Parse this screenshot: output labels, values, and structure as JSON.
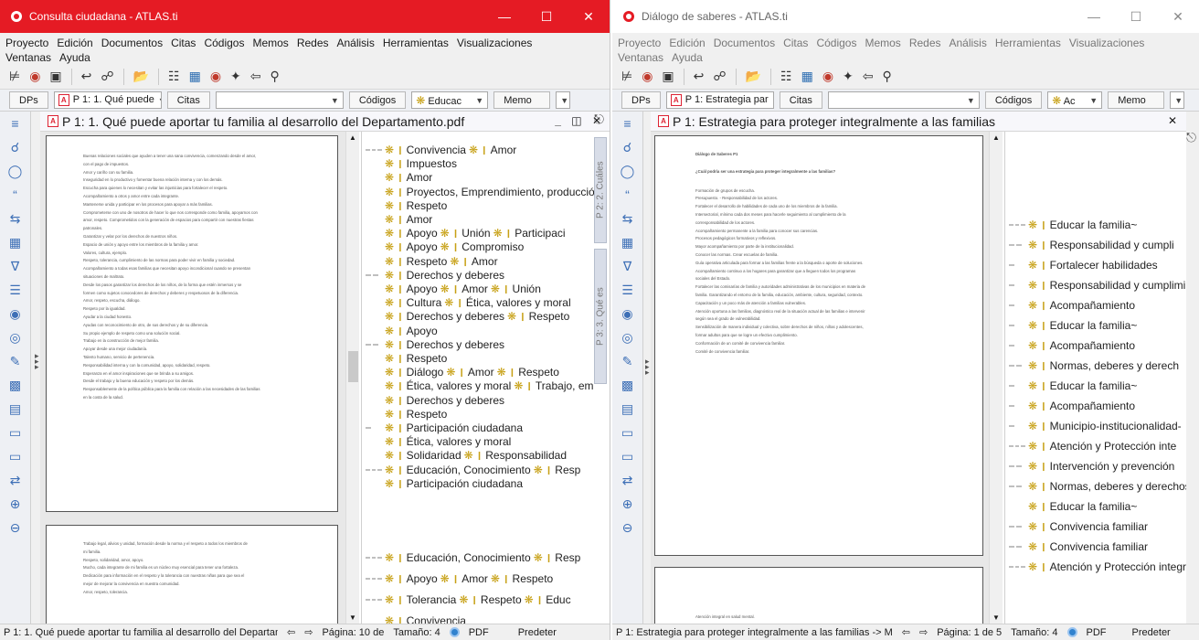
{
  "left": {
    "title": "Consulta ciudadana - ATLAS.ti",
    "menu": [
      "Proyecto",
      "Edición",
      "Documentos",
      "Citas",
      "Códigos",
      "Memos",
      "Redes",
      "Análisis",
      "Herramientas",
      "Visualizaciones",
      "Ventanas",
      "Ayuda"
    ],
    "nav": {
      "dps": "DPs",
      "doc_combo": "P 1: 1. Qué puede",
      "citas": "Citas",
      "citas_combo": "",
      "codigos": "Códigos",
      "codigos_combo": "Educac",
      "memo": "Memo"
    },
    "doc_title": "P 1: 1. Qué puede aportar tu familia al desarrollo del Departamento.pdf",
    "vtabs": [
      "P 2: 2. Cuáles",
      "P 3: 3. Qué es"
    ],
    "page1_lines": [
      "Buenas relaciones sociales que ayuden a tener una sana convivencia, comenzando desde el amor,",
      "con el pago de impuestos.",
      "Amor y cariño con su familia.",
      "Inseguridad en lo productivo y fomentar buena relación interna y con los demás.",
      "Escucha para quienes lo necesitan y evitar las injusticias para fortalecer el respeto.",
      "Acompañamiento a otros y amor entre cada integrante.",
      "Mantenerse unida y participar en los procesos para apoyar a más familias.",
      "Comprometerse con uno de nosotros de hacer lo que nos corresponde como familia, apoyarnos con",
      "amor, respeto. Comprometidos con la generación de espacios para compartir con nuestras fiestas",
      "patronales.",
      "Garantizar y velar por los derechos de nuestros niños.",
      "Espacio de unión y apoyo entre los miembros de la familia y amor.",
      "Valores, cultura, ejemplo.",
      "Respeto, tolerancia, cumplimiento de las normas para poder vivir en familia y sociedad.",
      "Acompañamiento a todas esas familias que necesitan apoyo incondicional cuando se presentan",
      "situaciones de maltrato.",
      "Desde los pasos garantizar los derechos de los niños, de la forma que estén inmersos y se",
      "formen como sujetos conocedores de derechos y deberes y respetuosos de la diferencia.",
      "Amor, respeto, escucha, diálogo.",
      "Respeto por la igualdad.",
      "Ayudar a la ciudad honesto.",
      "Ayudas con reconocimiento de otro, de sus derechos y de su diferencia.",
      "Su propio ejemplo de respeto como una solución social.",
      "Trabajo en la construcción de mejor familia.",
      "Apoyar desde una mejor ciudadanía.",
      "Talento humano, servicio de pertenencia.",
      "Responsabilidad interna y con la comunidad, apoyo, solidaridad, respeto.",
      "Esperanza en el amor inspiraciones que se brinda a su amigos.",
      "Desde el trabajo y la buena educación y respeto por los demás.",
      "Responsablemente de la política pública para la familia con relación a las necesidades de las familias",
      "en la costa de la salud."
    ],
    "page2_lines": [
      "Trabajo legal, alivios y unidad, formación desde la norma y el respeto a todos los miembros de",
      "mi familia.",
      "Respeto, solidaridad, amor, apoyo.",
      "Mucho, cada integrante de mi familia es un núcleo muy esencial para tener una fortaleza.",
      "Dedicación para información en el respeto y la tolerancia con nuestras niñas para que sea el",
      "mejor de mejorar la convivencia en nuestra comunidad.",
      "Amor, respeto, tolerancia."
    ],
    "codes": [
      {
        "bars": 3,
        "items": [
          "Convivencia",
          "Amor"
        ]
      },
      {
        "bars": 0,
        "items": [
          "Impuestos"
        ]
      },
      {
        "bars": 0,
        "items": [
          "Amor"
        ]
      },
      {
        "bars": 0,
        "items": [
          "Proyectos, Emprendimiento, producción"
        ]
      },
      {
        "bars": 0,
        "items": [
          "Respeto"
        ]
      },
      {
        "bars": 0,
        "items": [
          "Amor"
        ]
      },
      {
        "bars": 0,
        "items": [
          "Apoyo",
          "Unión",
          "Participaci"
        ]
      },
      {
        "bars": 0,
        "items": [
          "Apoyo",
          "Compromiso"
        ]
      },
      {
        "bars": 0,
        "items": [
          "Respeto",
          "Amor"
        ]
      },
      {
        "bars": 2,
        "items": [
          "Derechos y deberes"
        ]
      },
      {
        "bars": 0,
        "items": [
          "Apoyo",
          "Amor",
          "Unión"
        ]
      },
      {
        "bars": 0,
        "items": [
          "Cultura",
          "Ética, valores y moral"
        ]
      },
      {
        "bars": 0,
        "items": [
          "Derechos y deberes",
          "Respeto"
        ]
      },
      {
        "bars": 0,
        "items": [
          "Apoyo"
        ]
      },
      {
        "bars": 2,
        "items": [
          "Derechos y deberes"
        ]
      },
      {
        "bars": 0,
        "items": [
          "Respeto"
        ]
      },
      {
        "bars": 0,
        "items": [
          "Diálogo",
          "Amor",
          "Respeto"
        ]
      },
      {
        "bars": 0,
        "items": [
          "Ética, valores y moral",
          "Trabajo, em"
        ]
      },
      {
        "bars": 0,
        "items": [
          "Derechos y deberes"
        ]
      },
      {
        "bars": 0,
        "items": [
          "Respeto"
        ]
      },
      {
        "bars": 1,
        "items": [
          "Participación ciudadana"
        ]
      },
      {
        "bars": 0,
        "items": [
          "Ética, valores y moral"
        ]
      },
      {
        "bars": 0,
        "items": [
          "Solidaridad",
          "Responsabilidad"
        ]
      },
      {
        "bars": 3,
        "items": [
          "Educación, Conocimiento",
          "Resp"
        ]
      },
      {
        "bars": 0,
        "items": [
          "Participación ciudadana"
        ]
      }
    ],
    "codes_lower": [
      {
        "bars": 3,
        "items": [
          "Educación, Conocimiento",
          "Resp"
        ]
      },
      {
        "bars": 3,
        "items": [
          "Apoyo",
          "Amor",
          "Respeto"
        ]
      },
      {
        "bars": 3,
        "items": [
          "Tolerancia",
          "Respeto",
          "Educ"
        ]
      },
      {
        "bars": 0,
        "items": [
          "Convivencia"
        ]
      }
    ],
    "status": {
      "doc": "P 1: 1. Qué puede aportar tu familia al desarrollo del Departamento",
      "page": "Página: 10 de",
      "size": "Tamaño: 4",
      "type": "PDF",
      "mode": "Predeter"
    }
  },
  "right": {
    "title": "Diálogo de saberes - ATLAS.ti",
    "menu": [
      "Proyecto",
      "Edición",
      "Documentos",
      "Citas",
      "Códigos",
      "Memos",
      "Redes",
      "Análisis",
      "Herramientas",
      "Visualizaciones",
      "Ventanas",
      "Ayuda"
    ],
    "nav": {
      "dps": "DPs",
      "doc_combo": "P 1: Estrategia par",
      "citas": "Citas",
      "citas_combo": "",
      "codigos": "Códigos",
      "codigos_combo": "Ac",
      "memo": "Memo"
    },
    "doc_title": "P 1: Estrategia para proteger integralmente a las familias",
    "page_heading": "Diálogo de Saberes P1",
    "page_question": "¿Cuál podría ser una estrategia para proteger integralmente a las familias?",
    "page_lines": [
      "Formación de grupos de escucha.",
      "Presupuesto. - Responsabilidad de los actores.",
      "Fortalecer el desarrollo de habilidades de cada uno de los miembros de la familia.",
      "Intersectorial, mínimo cada dos meses para hacerle seguimiento al cumplimiento de la",
      "corresponsabilidad de los actores.",
      "Acompañamiento permanente a la familia para conocer sus carencias.",
      "Procesos pedagógicos formativos y reflexivos.",
      "Mayor acompañamiento por parte de la institucionalidad.",
      "Conocer las normas. Crear escuelas de familia.",
      "Guía operativa articulada para formar a las familias frente a la búsqueda o aporte de soluciones.",
      "Acompañamiento continuo a los hogares para garantizar que a lleguen todos los programas",
      "sociales del Estado.",
      "Fortalecer las comisarías de familia y autoridades administrativas de los municipios en materia de",
      "familia. Garantizando el entorno de la familia, educación, ambiente, cultura, seguridad, contexto.",
      "Capacitación y un poco más de atención a familias vulnerables.",
      "Atención oportuna a las familias, diagnóstico real de la situación actual de las familias e intervenir",
      "según sea el grado de vulnerabilidad.",
      "Sensibilización de manera individual y colectiva, sobre derechos de niños, niñas y adolescentes,",
      "formar adultos para que se logre un efectivo cumplimiento.",
      "Conformación de un comité de convivencia familiar.",
      "Comité de convivencia familiar."
    ],
    "page2_lines": [
      "Atención integral en salud mental."
    ],
    "codes": [
      {
        "bars": 3,
        "items": [
          "Educar la familia~"
        ]
      },
      {
        "bars": 2,
        "items": [
          "Responsabilidad y cumpli"
        ]
      },
      {
        "bars": 1,
        "items": [
          "Fortalecer habilidades"
        ]
      },
      {
        "bars": 1,
        "items": [
          "Responsabilidad y cumplimi"
        ]
      },
      {
        "bars": 1,
        "items": [
          "Acompañamiento"
        ]
      },
      {
        "bars": 1,
        "items": [
          "Educar la familia~"
        ]
      },
      {
        "bars": 1,
        "items": [
          "Acompañamiento"
        ]
      },
      {
        "bars": 2,
        "items": [
          "Normas, deberes y derech"
        ]
      },
      {
        "bars": 1,
        "items": [
          "Educar la familia~"
        ]
      },
      {
        "bars": 1,
        "items": [
          "Acompañamiento"
        ]
      },
      {
        "bars": 1,
        "items": [
          "Municipio-institucionalidad-"
        ]
      },
      {
        "bars": 3,
        "items": [
          "Atención y Protección inte"
        ]
      },
      {
        "bars": 2,
        "items": [
          "Intervención y prevención"
        ]
      },
      {
        "bars": 2,
        "items": [
          "Normas, deberes y derechos"
        ]
      },
      {
        "bars": 0,
        "items": [
          "Educar la familia~"
        ]
      },
      {
        "bars": 2,
        "items": [
          "Convivencia familiar"
        ]
      },
      {
        "bars": 2,
        "items": [
          "Convivencia familiar"
        ]
      },
      {
        "bars": 3,
        "items": [
          "Atención y Protección integr"
        ]
      }
    ],
    "status": {
      "doc": "P 1: Estrategia para proteger integralmente a las familias -> M",
      "page": "Página: 1 de 5",
      "size": "Tamaño: 4",
      "type": "PDF",
      "mode": "Predeter"
    }
  },
  "colors": {
    "accent": "#e51b24",
    "star": "#c7a014",
    "link": "#3d6fb6"
  }
}
